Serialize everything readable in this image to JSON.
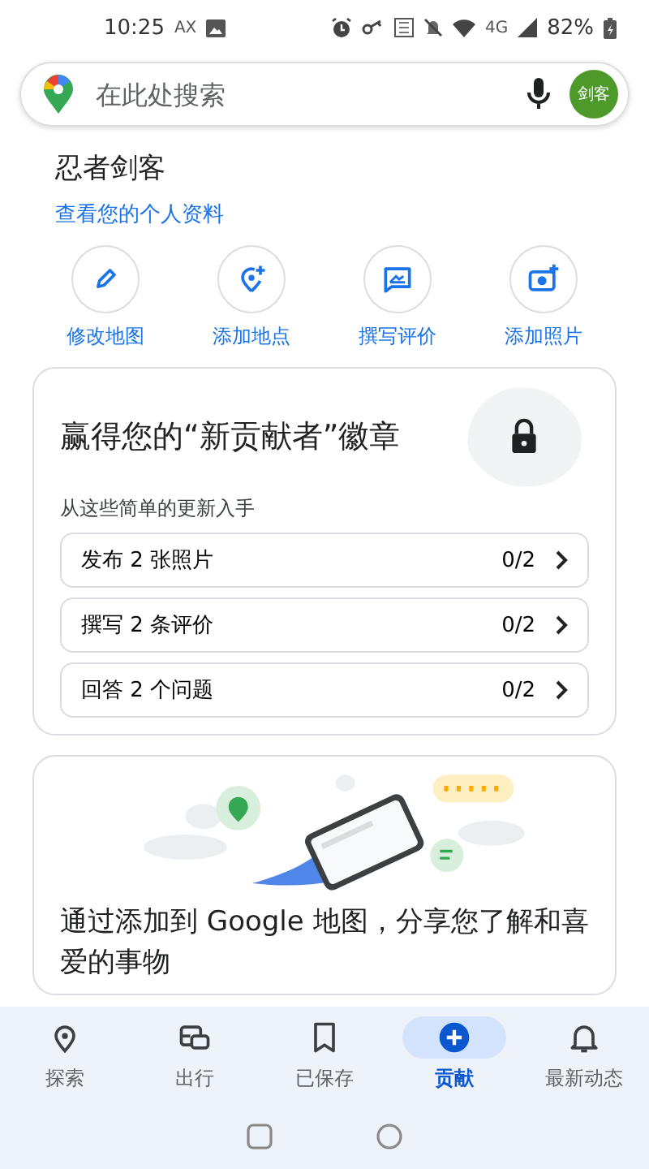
{
  "status_bar": {
    "time": "10:25",
    "carrier": "AX",
    "network": "4G",
    "battery": "82%"
  },
  "search": {
    "placeholder": "在此处搜索",
    "avatar": "剑客"
  },
  "profile": {
    "name": "忍者剑客",
    "link": "查看您的个人资料"
  },
  "actions": [
    {
      "label": "修改地图"
    },
    {
      "label": "添加地点"
    },
    {
      "label": "撰写评价"
    },
    {
      "label": "添加照片"
    }
  ],
  "badge_card": {
    "title": "赢得您的“新贡献者”徽章",
    "subtitle": "从这些简单的更新入手",
    "tasks": [
      {
        "label": "发布 2 张照片",
        "progress": "0/2"
      },
      {
        "label": "撰写 2 条评价",
        "progress": "0/2"
      },
      {
        "label": "回答 2 个问题",
        "progress": "0/2"
      }
    ]
  },
  "promo_card": {
    "text": "通过添加到 Google 地图，分享您了解和喜爱的事物"
  },
  "nav": {
    "items": [
      {
        "label": "探索",
        "selected": false
      },
      {
        "label": "出行",
        "selected": false
      },
      {
        "label": "已保存",
        "selected": false
      },
      {
        "label": "贡献",
        "selected": true
      },
      {
        "label": "最新动态",
        "selected": false
      }
    ]
  }
}
